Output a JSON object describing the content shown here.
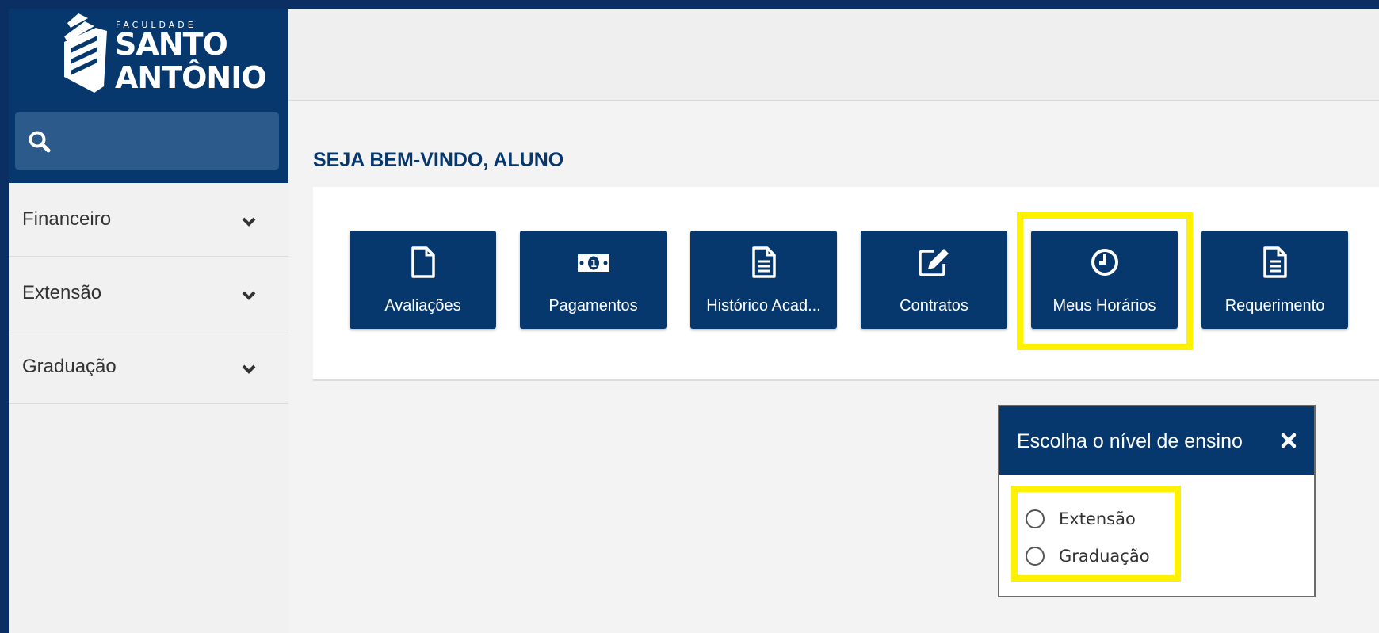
{
  "brand": {
    "small": "FACULDADE",
    "line1": "SANTO",
    "line2": "ANTÔNIO"
  },
  "search": {
    "icon": "search-icon"
  },
  "sidebar": {
    "items": [
      {
        "label": "Financeiro",
        "icon": "chevron-down-icon"
      },
      {
        "label": "Extensão",
        "icon": "chevron-down-icon"
      },
      {
        "label": "Graduação",
        "icon": "chevron-down-icon"
      }
    ]
  },
  "main": {
    "welcome": "SEJA BEM-VINDO, ALUNO",
    "tiles": [
      {
        "label": "Avaliações",
        "icon": "document-icon"
      },
      {
        "label": "Pagamentos",
        "icon": "money-icon"
      },
      {
        "label": "Histórico Acad...",
        "icon": "text-document-icon"
      },
      {
        "label": "Contratos",
        "icon": "edit-icon"
      },
      {
        "label": "Meus Horários",
        "icon": "clock-icon"
      },
      {
        "label": "Requerimento",
        "icon": "text-document-icon"
      }
    ]
  },
  "popup": {
    "title": "Escolha o nível de ensino",
    "close_icon": "close-icon",
    "options": [
      {
        "label": "Extensão",
        "checked": false
      },
      {
        "label": "Graduação",
        "checked": false
      }
    ]
  },
  "colors": {
    "primary": "#06386d",
    "highlight": "#fff200",
    "frame": "#0b2f63"
  }
}
